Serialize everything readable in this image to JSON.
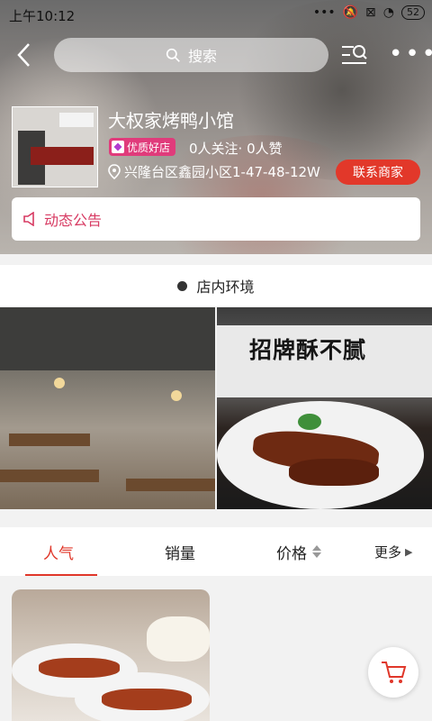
{
  "status_bar": {
    "time": "上午10:12",
    "battery": "52"
  },
  "search": {
    "placeholder": "搜索"
  },
  "shop": {
    "name": "大权家烤鸭小馆",
    "badge": "优质好店",
    "stats": "0人关注· 0人赞",
    "address": "兴隆台区鑫园小区1-47-48-12W",
    "contact_label": "联系商家",
    "notice_label": "动态公告"
  },
  "environment": {
    "title": "店内环境",
    "photo2_sign": "招牌酥不腻"
  },
  "tabs": [
    {
      "label": "人气",
      "active": true
    },
    {
      "label": "销量",
      "active": false
    },
    {
      "label": "价格",
      "active": false
    },
    {
      "label": "更多",
      "active": false
    }
  ],
  "colors": {
    "accent": "#e0372a",
    "badge": "#e03b7b",
    "notice": "#d73a62"
  }
}
